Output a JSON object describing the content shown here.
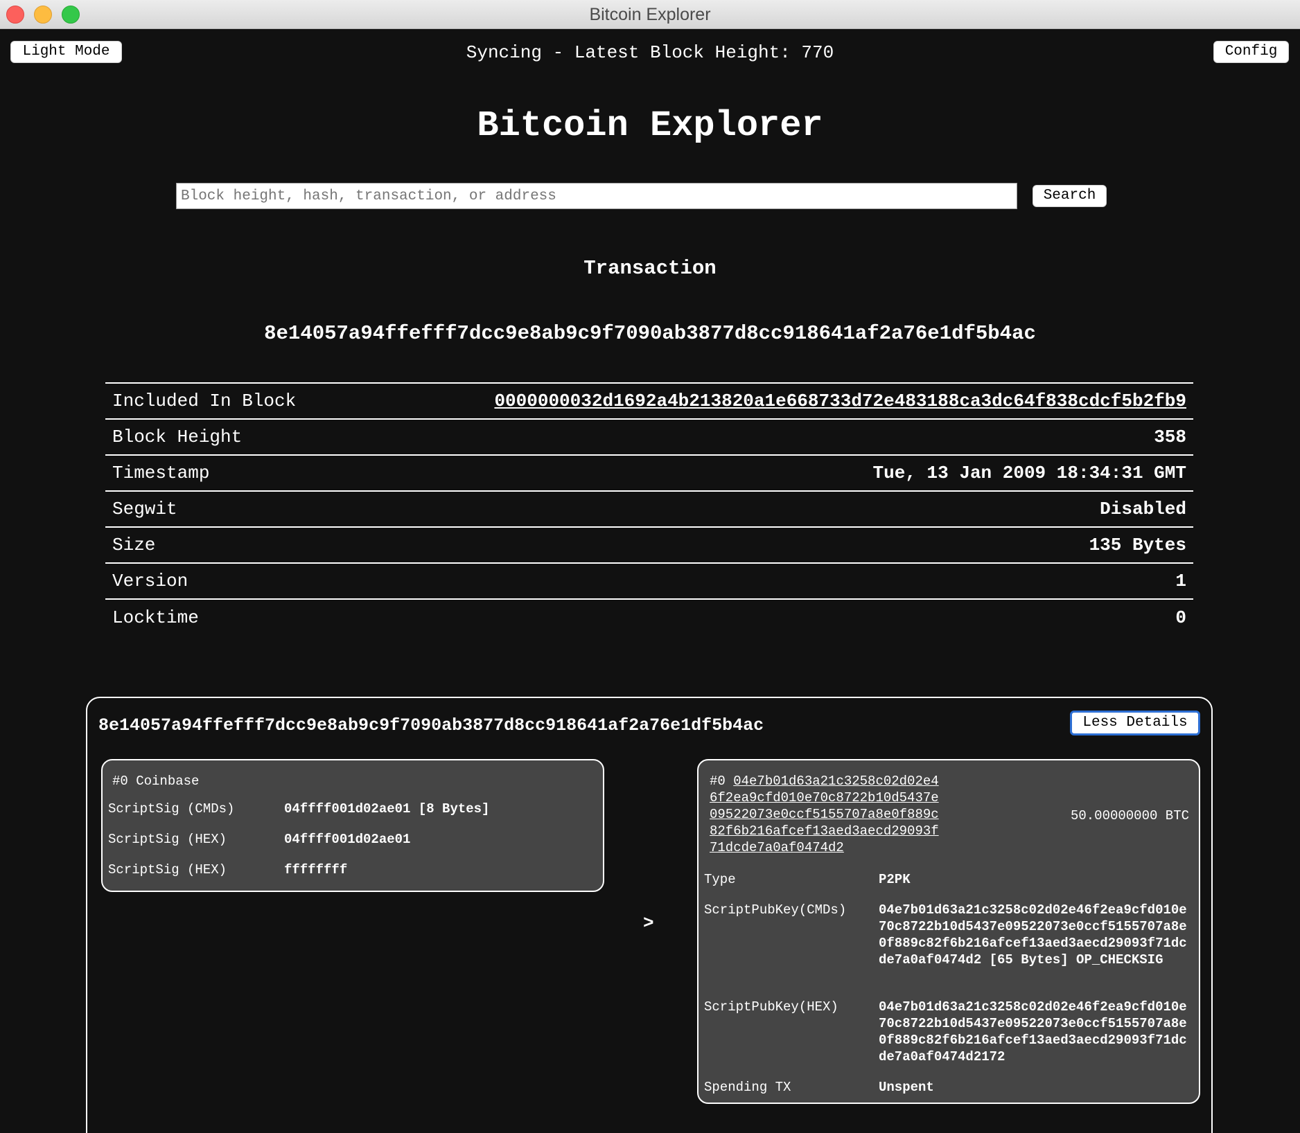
{
  "window": {
    "title": "Bitcoin Explorer"
  },
  "topbar": {
    "light_mode_label": "Light Mode",
    "sync_status": "Syncing - Latest Block Height: 770",
    "config_label": "Config"
  },
  "header": {
    "title": "Bitcoin Explorer"
  },
  "search": {
    "placeholder": "Block height, hash, transaction, or address",
    "button_label": "Search"
  },
  "transaction": {
    "section_title": "Transaction",
    "txid": "8e14057a94ffefff7dcc9e8ab9c9f7090ab3877d8cc918641af2a76e1df5b4ac",
    "details": [
      {
        "label": "Included In Block",
        "value": "0000000032d1692a4b213820a1e668733d72e483188ca3dc64f838cdcf5b2fb9"
      },
      {
        "label": "Block Height",
        "value": "358"
      },
      {
        "label": "Timestamp",
        "value": "Tue, 13 Jan 2009 18:34:31 GMT"
      },
      {
        "label": "Segwit",
        "value": "Disabled"
      },
      {
        "label": "Size",
        "value": "135 Bytes"
      },
      {
        "label": "Version",
        "value": "1"
      },
      {
        "label": "Locktime",
        "value": "0"
      }
    ]
  },
  "tx_card": {
    "txid": "8e14057a94ffefff7dcc9e8ab9c9f7090ab3877d8cc918641af2a76e1df5b4ac",
    "toggle_label": "Less Details",
    "arrow": ">",
    "input": {
      "heading": "#0 Coinbase",
      "rows": [
        {
          "label": "ScriptSig (CMDs)",
          "value": "04ffff001d02ae01 [8 Bytes]"
        },
        {
          "label": "ScriptSig (HEX)",
          "value": "04ffff001d02ae01"
        },
        {
          "label": "ScriptSig (HEX)",
          "value": "ffffffff"
        }
      ]
    },
    "output": {
      "index": "#0",
      "address": "04e7b01d63a21c3258c02d02e46f2ea9cfd010e70c8722b10d5437e09522073e0ccf5155707a8e0f889c82f6b216afcef13aed3aecd29093f71dcde7a0af0474d2",
      "amount": "50.00000000 BTC",
      "rows": [
        {
          "label": "Type",
          "value": "P2PK"
        },
        {
          "label": "ScriptPubKey(CMDs)",
          "value": "04e7b01d63a21c3258c02d02e46f2ea9cfd010e70c8722b10d5437e09522073e0ccf5155707a8e0f889c82f6b216afcef13aed3aecd29093f71dcde7a0af0474d2 [65 Bytes] OP_CHECKSIG"
        },
        {
          "label": "ScriptPubKey(HEX)",
          "value": "04e7b01d63a21c3258c02d02e46f2ea9cfd010e70c8722b10d5437e09522073e0ccf5155707a8e0f889c82f6b216afcef13aed3aecd29093f71dcde7a0af0474d2172"
        },
        {
          "label": "Spending TX",
          "value": "Unspent"
        }
      ]
    }
  }
}
